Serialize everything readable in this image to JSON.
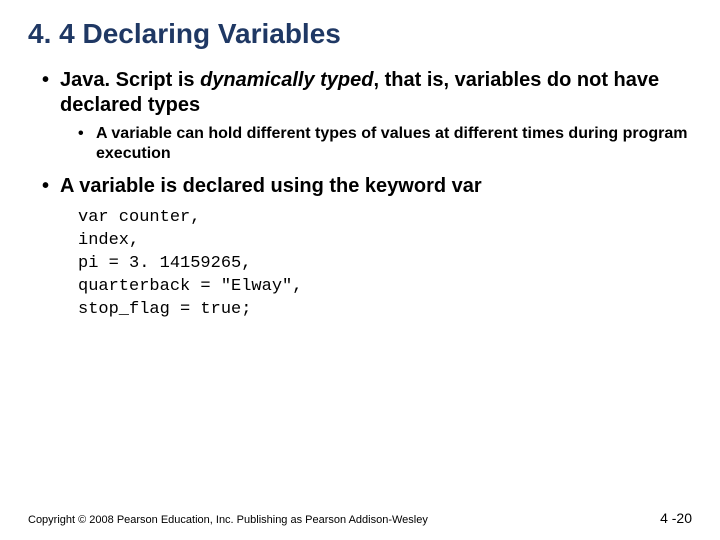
{
  "title": "4. 4 Declaring Variables",
  "bullets": {
    "b1_pre": "Java. Script is ",
    "b1_em": "dynamically typed",
    "b1_post": ", that is, variables do not have declared types",
    "b1_sub": "A variable can hold different types of values at different times during program execution",
    "b2": "A variable is declared using the keyword var"
  },
  "code": "var counter,\nindex,\npi = 3. 14159265,\nquarterback = \"Elway\",\nstop_flag = true;",
  "footer": "Copyright © 2008 Pearson Education, Inc. Publishing as Pearson Addison-Wesley",
  "pagenum": "4 -20"
}
